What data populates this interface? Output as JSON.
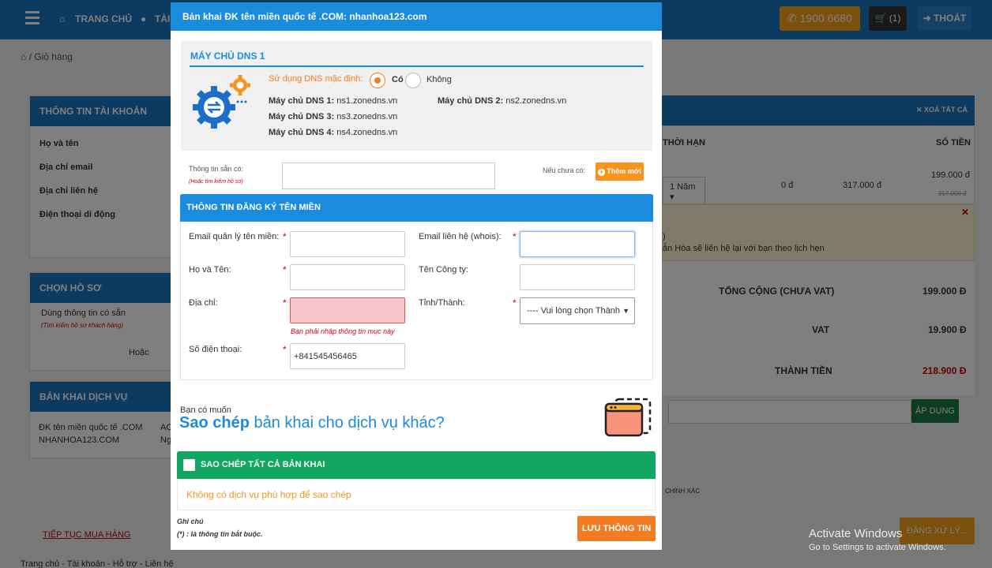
{
  "topbar": {
    "nav_home": "TRANG CHỦ",
    "nav_account": "TÀI",
    "hotline": "1900 6680",
    "cart": "(1)",
    "exit": "THOÁT"
  },
  "breadcrumb": {
    "sep": "/",
    "current": "Giỏ hàng"
  },
  "background": {
    "account_panel": {
      "title": "THÔNG TIN TÀI KHOẢN",
      "rows": [
        "Họ và tên",
        "Địa chỉ email",
        "Địa chỉ liên hệ",
        "Điện thoại di động"
      ]
    },
    "profile_panel": {
      "title": "CHỌN HỒ SƠ",
      "use_saved": "Dùng thông tin có sẵn",
      "hint": "(Tìm kiếm hồ sơ khách hàng)",
      "or": "Hoặc"
    },
    "service_panel": {
      "title": "BẢN KHAI DỊCH VỤ",
      "line1": "ĐK tên miền quốc tế .COM",
      "line2": "NHANHOA123.COM",
      "col1": "AC",
      "col2": "Ng"
    },
    "cart_header": {
      "remove_all": "✕ XOÁ TẤT CẢ",
      "duration": "THỜI HẠN",
      "amount": "SỐ TIỀN"
    },
    "cart_row": {
      "duration": "1 Năm",
      "discount": "0 đ",
      "price": "317.000 đ",
      "amount": "199.000 đ",
      "old_amount": "317.000 đ"
    },
    "notice_tail1": ")",
    "notice_tail2": "ẫn Hòa sẽ liên hệ lại với bạn theo lịch hẹn",
    "subtotal_label": "TỔNG CỘNG (CHƯA VAT)",
    "subtotal_value": "199.000 Đ",
    "vat_label": "VAT",
    "vat_value": "19.900 Đ",
    "total_label": "THÀNH TIỀN",
    "total_value": "218.900 Đ",
    "apply": "ÁP DỤNG",
    "confirm_tail": "CHÍNH XÁC",
    "continue": "TIẾP TỤC MUA HÀNG",
    "checkout": "ĐĂNG XỬ LÝ...",
    "footer_links": "Trang chủ - Tài khoản - Hỗ trợ - Liên hệ",
    "win_title": "Activate Windows",
    "win_sub": "Go to Settings to activate Windows."
  },
  "modal": {
    "title": "Bản khai ĐK tên miền quốc tế .COM: nhanhoa123.com",
    "dns": {
      "section_title": "MÁY CHỦ DNS 1",
      "use_default_label": "Sử dụng DNS mặc định:",
      "opt_yes": "Có",
      "opt_no": "Không",
      "selected": "Có",
      "dns1_label": "Máy chủ DNS 1:",
      "dns1": "ns1.zonedns.vn",
      "dns2_label": "Máy chủ DNS 2:",
      "dns2": "ns2.zonedns.vn",
      "dns3_label": "Máy chủ DNS 3:",
      "dns3": "ns3.zonedns.vn",
      "dns4_label": "Máy chủ DNS 4:",
      "dns4": "ns4.zonedns.vn"
    },
    "available_label": "Thông tin sẵn có:",
    "available_hint": "(Hoặc tìm kiếm hồ sơ)",
    "available_value": "",
    "new_label": "Nếu chưa có:",
    "add_new": "Thêm mới",
    "registration": {
      "title": "THÔNG TIN ĐĂNG KÝ TÊN MIỀN",
      "email_manage_label": "Email quản lý tên miền:",
      "email_manage_value": "",
      "email_contact_label": "Email liên hệ (whois):",
      "email_contact_value": "",
      "fullname_label": "Họ và Tên:",
      "fullname_value": "",
      "company_label": "Tên Công ty:",
      "company_value": "",
      "address_label": "Địa chỉ:",
      "address_value": "",
      "address_error": "Bạn phải nhập thông tin mục này",
      "province_label": "Tỉnh/Thành:",
      "province_selected": "---- Vui lòng chọn Thành",
      "phone_label": "Số điện thoại:",
      "phone_value": "+841545456465",
      "required_mark": "*"
    },
    "copy": {
      "question_small": "Bạn có muốn",
      "question_bold": "Sao chép",
      "question_rest": "bản khai cho dịch vụ khác?",
      "all_label": "SAO CHÉP TẤT CẢ BẢN KHAI",
      "empty": "Không có dịch vụ phù hợp để sao chép"
    },
    "note_title": "Ghi chú",
    "note_text": "(*) : là thông tin bắt buộc.",
    "save": "LƯU THÔNG TIN"
  },
  "colors": {
    "primary": "#1b8bde",
    "accent": "#f47b20",
    "success": "#11a661",
    "error": "#d0021b"
  }
}
